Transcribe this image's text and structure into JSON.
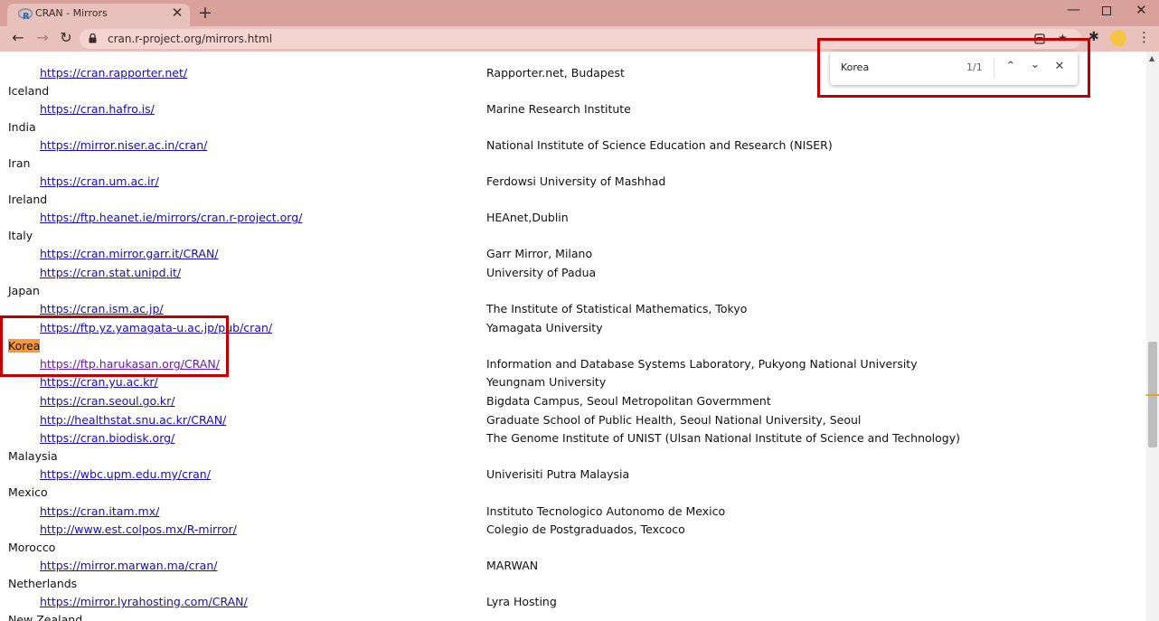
{
  "tab": {
    "favicon": "R",
    "title": "CRAN - Mirrors",
    "close": "✕",
    "new": "+"
  },
  "window": {
    "minimize": "—",
    "close": "✕"
  },
  "nav": {
    "back": "←",
    "forward": "→",
    "reload": "↻"
  },
  "omnibox": {
    "url": "cran.r-project.org/mirrors.html"
  },
  "toolbar": {
    "star": "★",
    "extensions": "✱",
    "menu": "⋮"
  },
  "find": {
    "query": "Korea",
    "count": "1/1",
    "prev": "⌃",
    "next": "⌄",
    "close": "✕"
  },
  "rows": [
    {
      "type": "mirror",
      "url": "https://cran.rapporter.net/",
      "desc": "Rapporter.net, Budapest"
    },
    {
      "type": "country",
      "name": "Iceland"
    },
    {
      "type": "mirror",
      "url": "https://cran.hafro.is/",
      "desc": "Marine Research Institute"
    },
    {
      "type": "country",
      "name": "India"
    },
    {
      "type": "mirror",
      "url": "https://mirror.niser.ac.in/cran/",
      "desc": "National Institute of Science Education and Research (NISER)"
    },
    {
      "type": "country",
      "name": "Iran"
    },
    {
      "type": "mirror",
      "url": "https://cran.um.ac.ir/",
      "desc": "Ferdowsi University of Mashhad"
    },
    {
      "type": "country",
      "name": "Ireland"
    },
    {
      "type": "mirror",
      "url": "https://ftp.heanet.ie/mirrors/cran.r-project.org/",
      "desc": "HEAnet,Dublin"
    },
    {
      "type": "country",
      "name": "Italy"
    },
    {
      "type": "mirror",
      "url": "https://cran.mirror.garr.it/CRAN/",
      "desc": "Garr Mirror, Milano"
    },
    {
      "type": "mirror",
      "url": "https://cran.stat.unipd.it/",
      "desc": "University of Padua"
    },
    {
      "type": "country",
      "name": "Japan"
    },
    {
      "type": "mirror",
      "url": "https://cran.ism.ac.jp/",
      "desc": "The Institute of Statistical Mathematics, Tokyo"
    },
    {
      "type": "mirror",
      "url": "https://ftp.yz.yamagata-u.ac.jp/pub/cran/",
      "desc": "Yamagata University"
    },
    {
      "type": "country",
      "name": "Korea",
      "highlight": true
    },
    {
      "type": "mirror",
      "url": "https://ftp.harukasan.org/CRAN/",
      "desc": "Information and Database Systems Laboratory, Pukyong National University",
      "visited": true
    },
    {
      "type": "mirror",
      "url": "https://cran.yu.ac.kr/",
      "desc": "Yeungnam University"
    },
    {
      "type": "mirror",
      "url": "https://cran.seoul.go.kr/",
      "desc": "Bigdata Campus, Seoul Metropolitan Govermment"
    },
    {
      "type": "mirror",
      "url": "http://healthstat.snu.ac.kr/CRAN/",
      "desc": "Graduate School of Public Health, Seoul National University, Seoul"
    },
    {
      "type": "mirror",
      "url": "https://cran.biodisk.org/",
      "desc": "The Genome Institute of UNIST (Ulsan National Institute of Science and Technology)"
    },
    {
      "type": "country",
      "name": "Malaysia"
    },
    {
      "type": "mirror",
      "url": "https://wbc.upm.edu.my/cran/",
      "desc": "Univerisiti Putra Malaysia"
    },
    {
      "type": "country",
      "name": "Mexico"
    },
    {
      "type": "mirror",
      "url": "https://cran.itam.mx/",
      "desc": "Instituto Tecnologico Autonomo de Mexico"
    },
    {
      "type": "mirror",
      "url": "http://www.est.colpos.mx/R-mirror/",
      "desc": "Colegio de Postgraduados, Texcoco"
    },
    {
      "type": "country",
      "name": "Morocco"
    },
    {
      "type": "mirror",
      "url": "https://mirror.marwan.ma/cran/",
      "desc": "MARWAN"
    },
    {
      "type": "country",
      "name": "Netherlands"
    },
    {
      "type": "mirror",
      "url": "https://mirror.lyrahosting.com/CRAN/",
      "desc": "Lyra Hosting"
    },
    {
      "type": "country",
      "name": "New Zealand"
    }
  ]
}
